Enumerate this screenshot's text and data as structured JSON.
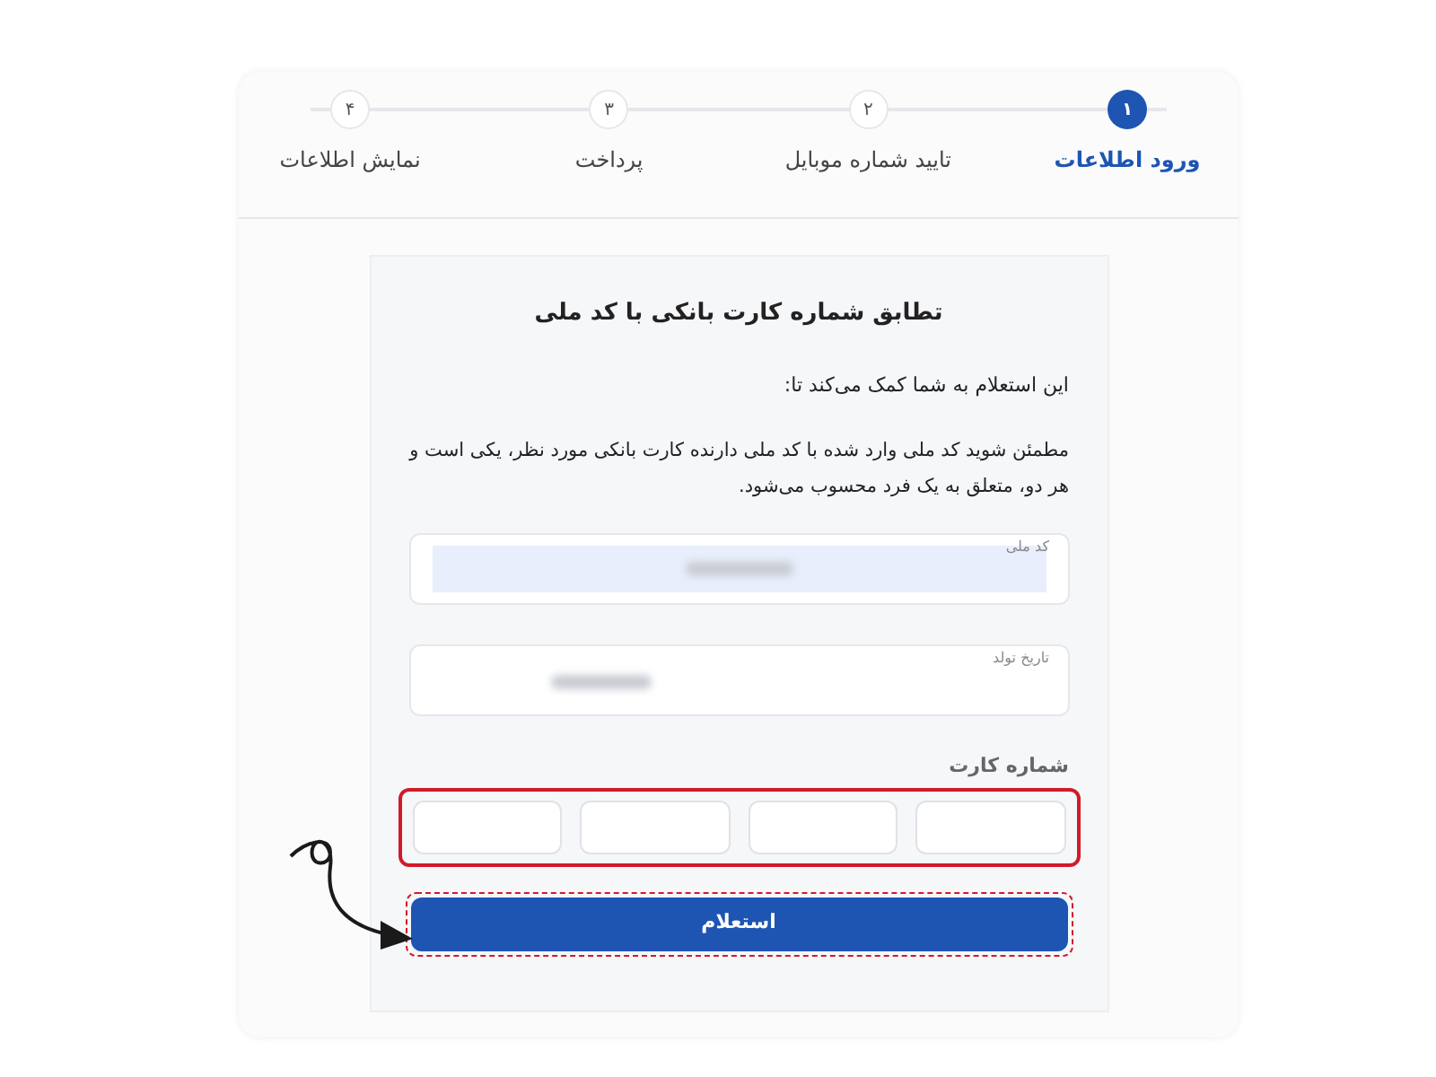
{
  "steps": [
    {
      "number": "۱",
      "label": "ورود اطلاعات",
      "selected": true
    },
    {
      "number": "۲",
      "label": "تایید شماره موبایل",
      "selected": false
    },
    {
      "number": "۳",
      "label": "پرداخت",
      "selected": false
    },
    {
      "number": "۴",
      "label": "نمایش اطلاعات",
      "selected": false
    }
  ],
  "card": {
    "title": "تطابق شماره کارت بانکی با کد ملی",
    "intro": "این استعلام به شما کمک می‌کند تا:",
    "description": "مطمئن شوید کد ملی وارد شده با کد ملی دارنده کارت بانکی مورد نظر، یکی است و هر دو، متعلق به یک فرد محسوب می‌شود."
  },
  "fields": [
    {
      "label": "کد ملی",
      "highlighted": true
    },
    {
      "label": "تاریخ تولد",
      "highlighted": false
    }
  ],
  "card_number": {
    "label": "شماره کارت",
    "annotated": true
  },
  "submit": {
    "label": "استعلام",
    "annotated": true
  }
}
